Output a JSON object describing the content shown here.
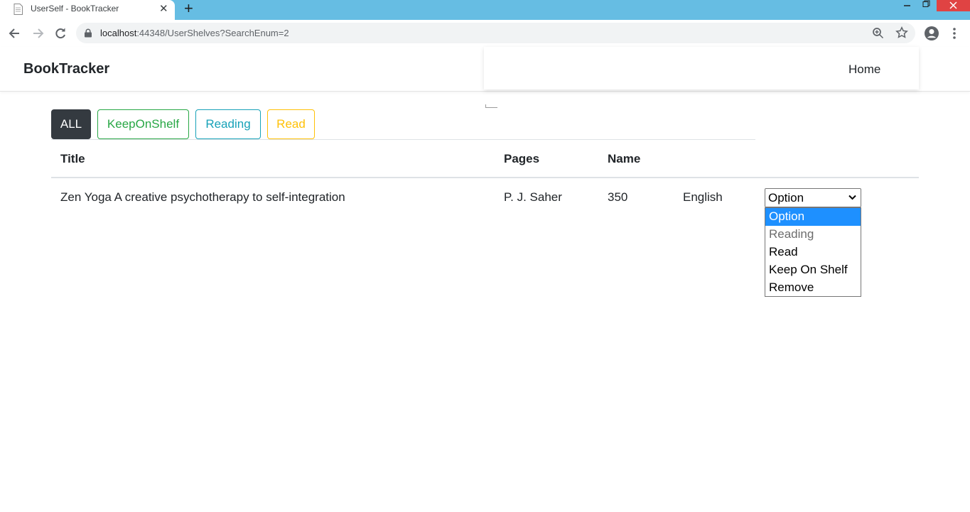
{
  "browser": {
    "tab_title": "UserSelf - BookTracker",
    "url_host": "localhost",
    "url_rest": ":44348/UserShelves?SearchEnum=2",
    "accent_color": "#66bde3"
  },
  "header": {
    "brand": "BookTracker",
    "nav_home": "Home"
  },
  "filters": {
    "all": "ALL",
    "keep_on_shelf": "KeepOnShelf",
    "reading": "Reading",
    "read": "Read",
    "colors": {
      "all": "#343a40",
      "keep_on_shelf": "#28a745",
      "reading": "#17a2b8",
      "read": "#ffc107"
    }
  },
  "table": {
    "headers": [
      "Title",
      "Pages",
      "Name"
    ],
    "rows": [
      {
        "title": "Zen Yoga A creative psychotherapy to self-integration",
        "author": "P. J. Saher",
        "pages": "350",
        "language": "English",
        "status_select": {
          "value": "Option",
          "options": [
            "Option",
            "Reading",
            "Read",
            "Keep On Shelf",
            "Remove"
          ],
          "highlighted": "Option",
          "disabled": [
            "Reading"
          ]
        }
      }
    ]
  }
}
